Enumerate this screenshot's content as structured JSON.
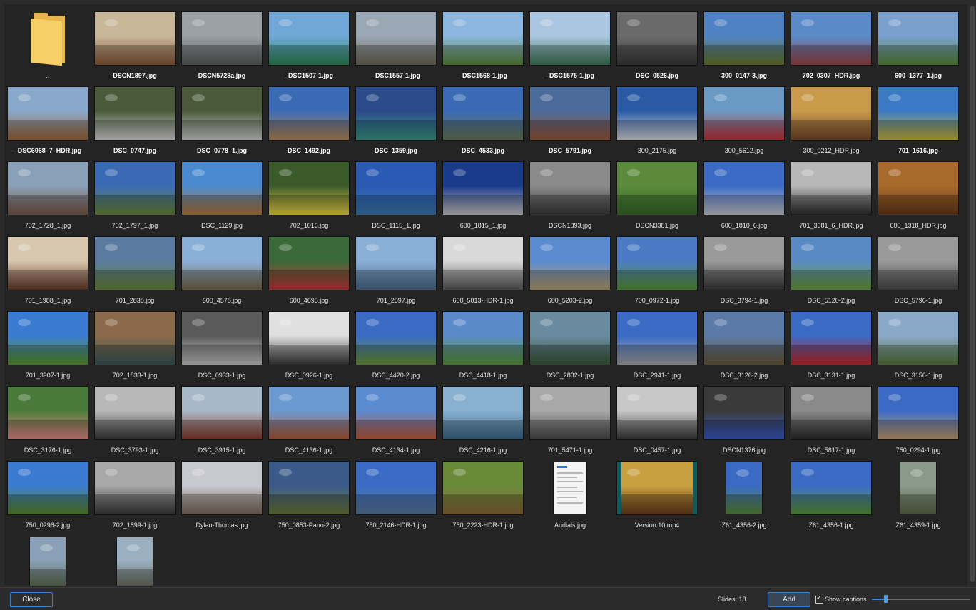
{
  "gallery": {
    "items": [
      {
        "name": "..",
        "type": "folder",
        "bold": false
      },
      {
        "name": "DSCN1897.jpg",
        "type": "image",
        "bold": true,
        "colors": [
          "#c9b79a",
          "#8a5a3a"
        ]
      },
      {
        "name": "DSCN5728a.jpg",
        "type": "image",
        "bold": true,
        "colors": [
          "#9aa0a6",
          "#5d5d5d"
        ]
      },
      {
        "name": "_DSC1507-1.jpg",
        "type": "image",
        "bold": true,
        "colors": [
          "#6fa8d6",
          "#2e8a5a"
        ]
      },
      {
        "name": "_DSC1557-1.jpg",
        "type": "image",
        "bold": true,
        "colors": [
          "#9aa7b4",
          "#6e6a5a"
        ]
      },
      {
        "name": "_DSC1568-1.jpg",
        "type": "image",
        "bold": true,
        "colors": [
          "#8bb6de",
          "#5d8a3a"
        ]
      },
      {
        "name": "_DSC1575-1.jpg",
        "type": "image",
        "bold": true,
        "colors": [
          "#aac6e0",
          "#3f7a5a"
        ]
      },
      {
        "name": "DSC_0526.jpg",
        "type": "image",
        "bold": true,
        "colors": [
          "#6a6a6a",
          "#3a3a3a"
        ]
      },
      {
        "name": "300_0147-3.jpg",
        "type": "image",
        "bold": true,
        "colors": [
          "#4f82c4",
          "#6a7a2a"
        ]
      },
      {
        "name": "702_0307_HDR.jpg",
        "type": "image",
        "bold": true,
        "colors": [
          "#5a8ac8",
          "#a0464a"
        ]
      },
      {
        "name": "600_1377_1.jpg",
        "type": "image",
        "bold": true,
        "colors": [
          "#7aa0d0",
          "#5a8a3a"
        ]
      },
      {
        "name": "_DSC6068_7_HDR.jpg",
        "type": "image",
        "bold": true,
        "colors": [
          "#8aa8cc",
          "#a06a3a"
        ]
      },
      {
        "name": "DSC_0747.jpg",
        "type": "image",
        "bold": true,
        "colors": [
          "#4a5a3a",
          "#d8d8d8"
        ]
      },
      {
        "name": "DSC_0778_1.jpg",
        "type": "image",
        "bold": true,
        "colors": [
          "#4a5a3a",
          "#d0d0d0"
        ]
      },
      {
        "name": "DSC_1492.jpg",
        "type": "image",
        "bold": true,
        "colors": [
          "#3a6ab4",
          "#b88a5a"
        ]
      },
      {
        "name": "DSC_1359.jpg",
        "type": "image",
        "bold": true,
        "colors": [
          "#2a4a8a",
          "#3a9a8a"
        ]
      },
      {
        "name": "DSC_4533.jpg",
        "type": "image",
        "bold": true,
        "colors": [
          "#3a6ab4",
          "#6a7a5a"
        ]
      },
      {
        "name": "DSC_5791.jpg",
        "type": "image",
        "bold": true,
        "colors": [
          "#4a6a9a",
          "#9a5a3a"
        ]
      },
      {
        "name": "300_2175.jpg",
        "type": "image",
        "bold": false,
        "colors": [
          "#2a5aa4",
          "#d8d8e0"
        ]
      },
      {
        "name": "300_5612.jpg",
        "type": "image",
        "bold": false,
        "colors": [
          "#6a9ac4",
          "#c8343a"
        ]
      },
      {
        "name": "300_0212_HDR.jpg",
        "type": "image",
        "bold": false,
        "colors": [
          "#c89a4a",
          "#7a4a2a"
        ]
      },
      {
        "name": "701_1616.jpg",
        "type": "image",
        "bold": true,
        "colors": [
          "#3a7ac4",
          "#c8b83a"
        ]
      },
      {
        "name": "702_1728_1.jpg",
        "type": "image",
        "bold": false,
        "colors": [
          "#8aa0b8",
          "#7a5a4a"
        ]
      },
      {
        "name": "702_1797_1.jpg",
        "type": "image",
        "bold": false,
        "colors": [
          "#3a6ab4",
          "#6a8a3a"
        ]
      },
      {
        "name": "DSC_1129.jpg",
        "type": "image",
        "bold": false,
        "colors": [
          "#4a8ad0",
          "#b87a3a"
        ]
      },
      {
        "name": "702_1015.jpg",
        "type": "image",
        "bold": false,
        "colors": [
          "#3a5a2a",
          "#f0d84a"
        ]
      },
      {
        "name": "DSC_1115_1.jpg",
        "type": "image",
        "bold": false,
        "colors": [
          "#2a5ab4",
          "#3a7ab0"
        ]
      },
      {
        "name": "600_1815_1.jpg",
        "type": "image",
        "bold": false,
        "colors": [
          "#1a3a8a",
          "#c8c8c8"
        ]
      },
      {
        "name": "DSCN1893.jpg",
        "type": "image",
        "bold": false,
        "colors": [
          "#8a8a8a",
          "#3a3a3a"
        ]
      },
      {
        "name": "DSCN3381.jpg",
        "type": "image",
        "bold": false,
        "colors": [
          "#5a8a3a",
          "#3a6a2a"
        ]
      },
      {
        "name": "600_1810_6.jpg",
        "type": "image",
        "bold": false,
        "colors": [
          "#3a6ac4",
          "#c8c8d0"
        ]
      },
      {
        "name": "701_3681_6_HDR.jpg",
        "type": "image",
        "bold": false,
        "colors": [
          "#b8b8b8",
          "#2a2a2a"
        ]
      },
      {
        "name": "600_1318_HDR.jpg",
        "type": "image",
        "bold": false,
        "colors": [
          "#a86a2a",
          "#6a3a1a"
        ]
      },
      {
        "name": "701_1988_1.jpg",
        "type": "image",
        "bold": false,
        "colors": [
          "#d8c8b0",
          "#6a3a2a"
        ]
      },
      {
        "name": "701_2838.jpg",
        "type": "image",
        "bold": false,
        "colors": [
          "#5a7aa0",
          "#6a8a3a"
        ]
      },
      {
        "name": "600_4578.jpg",
        "type": "image",
        "bold": false,
        "colors": [
          "#8ab0d8",
          "#7a6a4a"
        ]
      },
      {
        "name": "600_4695.jpg",
        "type": "image",
        "bold": false,
        "colors": [
          "#3a6a3a",
          "#c83a3a"
        ]
      },
      {
        "name": "701_2597.jpg",
        "type": "image",
        "bold": false,
        "colors": [
          "#8ab0d8",
          "#4a6a8a"
        ]
      },
      {
        "name": "600_5013-HDR-1.jpg",
        "type": "image",
        "bold": false,
        "colors": [
          "#d8d8d8",
          "#5a5a5a"
        ]
      },
      {
        "name": "600_5203-2.jpg",
        "type": "image",
        "bold": false,
        "colors": [
          "#5a8ad0",
          "#b8a070"
        ]
      },
      {
        "name": "700_0972-1.jpg",
        "type": "image",
        "bold": false,
        "colors": [
          "#4a7ac4",
          "#5a9a3a"
        ]
      },
      {
        "name": "DSC_3794-1.jpg",
        "type": "image",
        "bold": false,
        "colors": [
          "#9a9a9a",
          "#3a3a3a"
        ]
      },
      {
        "name": "DSC_5120-2.jpg",
        "type": "image",
        "bold": false,
        "colors": [
          "#5a8ac4",
          "#6aa03a"
        ]
      },
      {
        "name": "DSC_5796-1.jpg",
        "type": "image",
        "bold": false,
        "colors": [
          "#9a9a9a",
          "#4a4a4a"
        ]
      },
      {
        "name": "701_3907-1.jpg",
        "type": "image",
        "bold": false,
        "colors": [
          "#3a7ad0",
          "#5a9a2a"
        ]
      },
      {
        "name": "702_1833-1.jpg",
        "type": "image",
        "bold": false,
        "colors": [
          "#8a6a4a",
          "#3a5a5a"
        ]
      },
      {
        "name": "DSC_0933-1.jpg",
        "type": "image",
        "bold": false,
        "colors": [
          "#5a5a5a",
          "#c8c8c8"
        ]
      },
      {
        "name": "DSC_0926-1.jpg",
        "type": "image",
        "bold": false,
        "colors": [
          "#e0e0e0",
          "#3a3a3a"
        ]
      },
      {
        "name": "DSC_4420-2.jpg",
        "type": "image",
        "bold": false,
        "colors": [
          "#3a6ac4",
          "#6a9a3a"
        ]
      },
      {
        "name": "DSC_4418-1.jpg",
        "type": "image",
        "bold": false,
        "colors": [
          "#5a8ac8",
          "#5a9a3a"
        ]
      },
      {
        "name": "DSC_2832-1.jpg",
        "type": "image",
        "bold": false,
        "colors": [
          "#6a8aa0",
          "#3a5a3a"
        ]
      },
      {
        "name": "DSC_2941-1.jpg",
        "type": "image",
        "bold": false,
        "colors": [
          "#3a6ac4",
          "#a8a8a8"
        ]
      },
      {
        "name": "DSC_3126-2.jpg",
        "type": "image",
        "bold": false,
        "colors": [
          "#5a7aa8",
          "#6a5a3a"
        ]
      },
      {
        "name": "DSC_3131-1.jpg",
        "type": "image",
        "bold": false,
        "colors": [
          "#3a6ac4",
          "#c82a2a"
        ]
      },
      {
        "name": "DSC_3156-1.jpg",
        "type": "image",
        "bold": false,
        "colors": [
          "#8aa8c8",
          "#5a7a3a"
        ]
      },
      {
        "name": "DSC_3176-1.jpg",
        "type": "image",
        "bold": false,
        "colors": [
          "#4a7a3a",
          "#e88a8a"
        ]
      },
      {
        "name": "DSC_3793-1.jpg",
        "type": "image",
        "bold": false,
        "colors": [
          "#b8b8b8",
          "#3a3a3a"
        ]
      },
      {
        "name": "DSC_3915-1.jpg",
        "type": "image",
        "bold": false,
        "colors": [
          "#a8b8c8",
          "#8a3a2a"
        ]
      },
      {
        "name": "DSC_4136-1.jpg",
        "type": "image",
        "bold": false,
        "colors": [
          "#6a9ad0",
          "#b85a3a"
        ]
      },
      {
        "name": "DSC_4134-1.jpg",
        "type": "image",
        "bold": false,
        "colors": [
          "#5a8ad0",
          "#c85a3a"
        ]
      },
      {
        "name": "DSC_4216-1.jpg",
        "type": "image",
        "bold": false,
        "colors": [
          "#8ab0d0",
          "#3a6a8a"
        ]
      },
      {
        "name": "701_5471-1.jpg",
        "type": "image",
        "bold": false,
        "colors": [
          "#a8a8a8",
          "#4a4a4a"
        ]
      },
      {
        "name": "DSC_0457-1.jpg",
        "type": "image",
        "bold": false,
        "colors": [
          "#c8c8c8",
          "#3a3a3a"
        ]
      },
      {
        "name": "DSCN1376.jpg",
        "type": "image",
        "bold": false,
        "colors": [
          "#3a3a3a",
          "#3a5ac8"
        ]
      },
      {
        "name": "DSC_5817-1.jpg",
        "type": "image",
        "bold": false,
        "colors": [
          "#8a8a8a",
          "#2a2a2a"
        ]
      },
      {
        "name": "750_0294-1.jpg",
        "type": "image",
        "bold": false,
        "colors": [
          "#3a6ac4",
          "#c8a070"
        ]
      },
      {
        "name": "750_0296-2.jpg",
        "type": "image",
        "bold": false,
        "colors": [
          "#3a7ad0",
          "#5a8a2a"
        ]
      },
      {
        "name": "702_1899-1.jpg",
        "type": "image",
        "bold": false,
        "colors": [
          "#a8a8a8",
          "#3a3a3a"
        ]
      },
      {
        "name": "Dylan-Thomas.jpg",
        "type": "image",
        "bold": false,
        "colors": [
          "#c8c8d0",
          "#7a6a5a"
        ]
      },
      {
        "name": "750_0853-Pano-2.jpg",
        "type": "image",
        "bold": false,
        "colors": [
          "#3a5a8a",
          "#6a7a3a"
        ]
      },
      {
        "name": "750_2146-HDR-1.jpg",
        "type": "image",
        "bold": false,
        "colors": [
          "#3a6ac4",
          "#5a7a9a"
        ]
      },
      {
        "name": "750_2223-HDR-1.jpg",
        "type": "image",
        "bold": false,
        "colors": [
          "#6a8a3a",
          "#8a6a3a"
        ]
      },
      {
        "name": "Audials.jpg",
        "type": "document",
        "bold": false
      },
      {
        "name": "Version 10.mp4",
        "type": "video",
        "bold": false,
        "colors": [
          "#c8a040",
          "#6a3a1a"
        ]
      },
      {
        "name": "Z61_4356-2.jpg",
        "type": "portrait",
        "bold": false,
        "colors": [
          "#3a6ac4",
          "#5a8a3a"
        ]
      },
      {
        "name": "Z61_4356-1.jpg",
        "type": "image",
        "bold": false,
        "colors": [
          "#3a6ac4",
          "#5a9a3a"
        ]
      },
      {
        "name": "Z61_4359-1.jpg",
        "type": "portrait",
        "bold": false,
        "colors": [
          "#8a9a8a",
          "#5a6a4a"
        ]
      },
      {
        "name": "",
        "type": "portrait",
        "bold": false,
        "colors": [
          "#8aa0b8",
          "#5a6a4a"
        ]
      },
      {
        "name": "",
        "type": "portrait",
        "bold": false,
        "colors": [
          "#9ab0c0",
          "#6a6a5a"
        ]
      }
    ]
  },
  "footer": {
    "close_label": "Close",
    "slides_label": "Slides: 18",
    "add_label": "Add",
    "show_captions_label": "Show captions",
    "show_captions_checked": true,
    "zoom_level": 0.14
  },
  "colors": {
    "accent": "#3f7fc8",
    "folder": "#f7cf67",
    "background": "#242424"
  }
}
